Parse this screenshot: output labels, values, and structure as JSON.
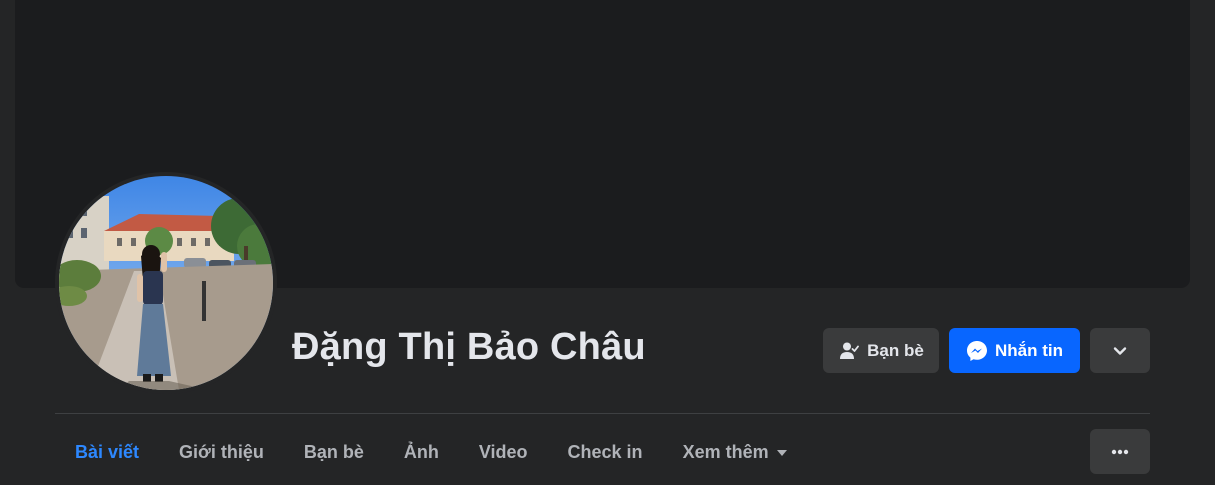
{
  "profile": {
    "name": "Đặng Thị Bảo Châu"
  },
  "actions": {
    "friends_label": "Bạn bè",
    "message_label": "Nhắn tin",
    "friends_icon": "friend-check-icon",
    "message_icon": "messenger-icon",
    "dropdown_icon": "chevron-down-icon"
  },
  "tabs": [
    {
      "label": "Bài viết",
      "active": true
    },
    {
      "label": "Giới thiệu",
      "active": false
    },
    {
      "label": "Bạn bè",
      "active": false
    },
    {
      "label": "Ảnh",
      "active": false
    },
    {
      "label": "Video",
      "active": false
    },
    {
      "label": "Check in",
      "active": false
    },
    {
      "label": "Xem thêm",
      "active": false
    }
  ],
  "more_icon": "ellipsis-icon",
  "colors": {
    "background": "#242526",
    "cover": "#1b1c1e",
    "accent": "#0866ff",
    "active_tab": "#2d88ff",
    "secondary_button": "#3a3b3c",
    "text_primary": "#e4e6eb",
    "text_secondary": "#b0b3b8"
  }
}
